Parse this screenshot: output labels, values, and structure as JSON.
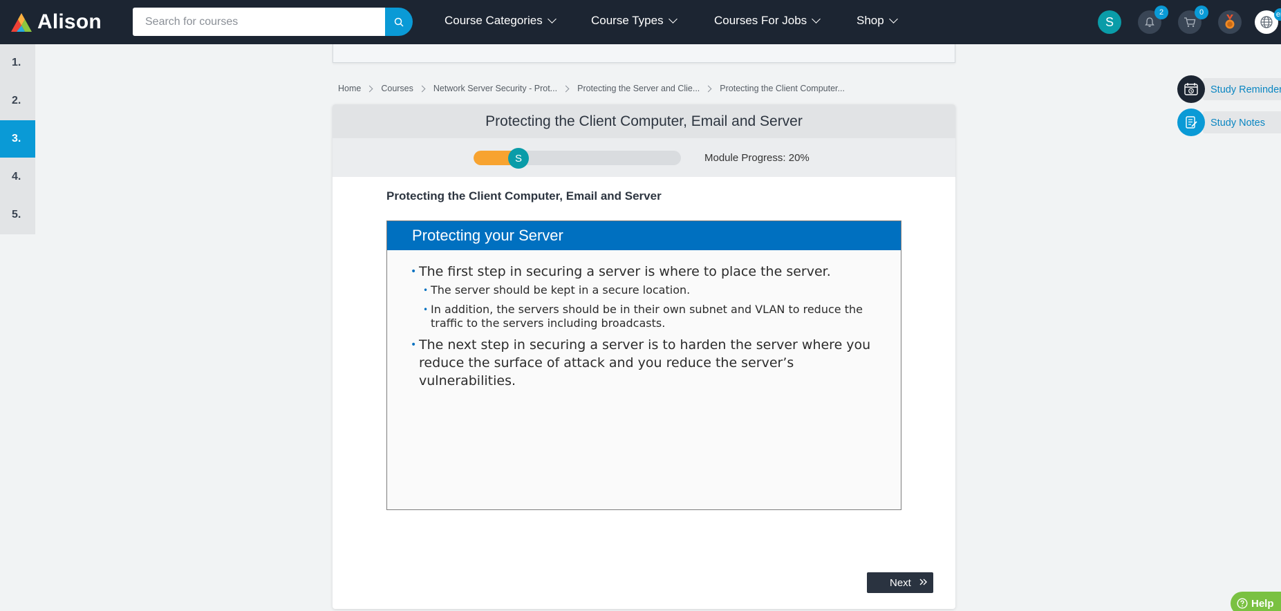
{
  "brand": {
    "name": "Alison"
  },
  "search": {
    "placeholder": "Search for courses"
  },
  "nav": {
    "items": [
      {
        "label": "Course Categories"
      },
      {
        "label": "Course Types"
      },
      {
        "label": "Courses For Jobs"
      },
      {
        "label": "Shop"
      }
    ]
  },
  "header_icons": {
    "avatar_letter": "S",
    "notifications_count": "2",
    "cart_count": "0",
    "language": "en"
  },
  "left_rail": {
    "items": [
      "1.",
      "2.",
      "3.",
      "4.",
      "5."
    ],
    "active_index": 2
  },
  "breadcrumb": [
    "Home",
    "Courses",
    "Network Server Security - Prot...",
    "Protecting the Server and Clie...",
    "Protecting the Client Computer..."
  ],
  "module": {
    "title": "Protecting the Client Computer, Email and Server",
    "progress_label": "Module Progress: 20%",
    "progress_fraction": 0.2,
    "progress_avatar": "S",
    "section_title": "Protecting the Client Computer, Email and Server"
  },
  "slide": {
    "heading": "Protecting your Server",
    "bullets": [
      {
        "text": "The first step in securing a server is where to place the server.",
        "sub": [
          "The server should be kept in a secure location.",
          "In addition, the servers should be in their own subnet and VLAN to reduce the traffic to the servers including broadcasts."
        ]
      },
      {
        "text": "The next step in securing a server is to harden the server where you reduce the surface of attack and you reduce the server’s vulnerabilities.",
        "sub": []
      }
    ]
  },
  "actions": {
    "next_label": "Next"
  },
  "study_widgets": {
    "reminders_label": "Study Reminders",
    "notes_label": "Study Notes"
  },
  "help": {
    "label": "Help"
  },
  "colors": {
    "navbar": "#1c2532",
    "accent_blue": "#0a9ad6",
    "progress_orange": "#f7a330",
    "slide_header_blue": "#0070c0",
    "help_green": "#7ac142"
  }
}
